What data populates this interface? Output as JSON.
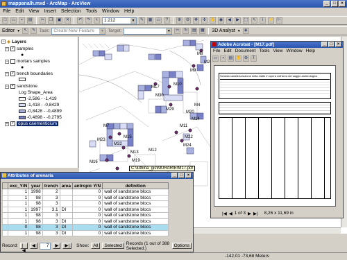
{
  "app": {
    "title": "mappanalh.mxd - ArcMap - ArcView"
  },
  "menu": [
    "File",
    "Edit",
    "View",
    "Insert",
    "Selection",
    "Tools",
    "Window",
    "Help"
  ],
  "toolbar": {
    "scale": "1:212",
    "editor_label": "Editor",
    "task_label": "Task:",
    "task_value": "Create New Feature",
    "target_label": "Target:",
    "analyst_label": "3D Analyst"
  },
  "toc": {
    "root": "Layers",
    "layers": [
      {
        "name": "samples",
        "checked": true
      },
      {
        "name": "mortars samples",
        "checked": false
      },
      {
        "name": "trench boundaries",
        "checked": true
      },
      {
        "name": "sandstone",
        "checked": true,
        "legend_title": "Log Shape_Area",
        "classes": [
          {
            "label": "-2,586 - -1,419",
            "color": "#ffffff"
          },
          {
            "label": "-1,418 - -0,8429",
            "color": "#d8dcf4"
          },
          {
            "label": "-0,8428 - -0,4899",
            "color": "#a8b0e0"
          },
          {
            "label": "-0,4898 - -0,2795",
            "color": "#7880c8"
          }
        ]
      },
      {
        "name": "opus caementicium",
        "checked": true,
        "selected": true
      }
    ]
  },
  "map": {
    "labels": [
      "M4",
      "M7",
      "M8",
      "M9",
      "M10",
      "M11",
      "M12",
      "M13",
      "M14",
      "M15",
      "M16",
      "M17",
      "M19",
      "M20",
      "M22",
      "M23",
      "M24",
      "M25",
      "M29",
      "M30",
      "M32"
    ]
  },
  "hyperlink": "C:\\luthina_gis\\MURARIE\\M17.pdf",
  "pdf": {
    "title": "Adobe Acrobat - [M17.pdf]",
    "menu": [
      "File",
      "Edit",
      "Document",
      "Tools",
      "View",
      "Window",
      "Help"
    ],
    "heading": "Scheda caratterizzazione della malte in opera nell'area del saggio archeologico",
    "page_nav": "1 of 3",
    "page_size": "8,26 x 11,69 in"
  },
  "attributes": {
    "title": "Attributes of arenaria",
    "columns": [
      "exc_Y/N",
      "year",
      "trench",
      "area",
      "antropic Y/N",
      "definition"
    ],
    "rows": [
      [
        "1",
        "1998",
        "2",
        "",
        "0",
        "wall of sandstone blocs"
      ],
      [
        "1",
        "98",
        "3",
        "",
        "0",
        "wall of sandstone blocs"
      ],
      [
        "1",
        "98",
        "3",
        "",
        "0",
        "wall of sandstone blocs"
      ],
      [
        "1",
        "1997",
        "3.1",
        "DI",
        "0",
        "wall of sandstone blocs"
      ],
      [
        "1",
        "98",
        "3",
        "",
        "0",
        "wall of sandstone blocs"
      ],
      [
        "1",
        "98",
        "3",
        "DI",
        "0",
        "wall of sandstone blocs"
      ],
      [
        "0",
        "98",
        "3",
        "DI",
        "0",
        "wall of sandstone blocs"
      ],
      [
        "1",
        "98",
        "3",
        "DI",
        "0",
        "wall of sandstone blocs"
      ]
    ],
    "highlight_row": 6,
    "record_label": "Record:",
    "record_value": "7",
    "show_label": "Show:",
    "all_label": "All",
    "selected_label": "Selected",
    "records_text": "Records (1 out of 388 Selected.)",
    "options_label": "Options"
  },
  "status": {
    "coords": "-142,01  -73,68 Meters"
  },
  "colors": {
    "titlebar": "#2a56b0",
    "selection": "#0a246a",
    "class1": "#d8dcf4",
    "class2": "#a8b0e0",
    "class3": "#7880c8"
  }
}
